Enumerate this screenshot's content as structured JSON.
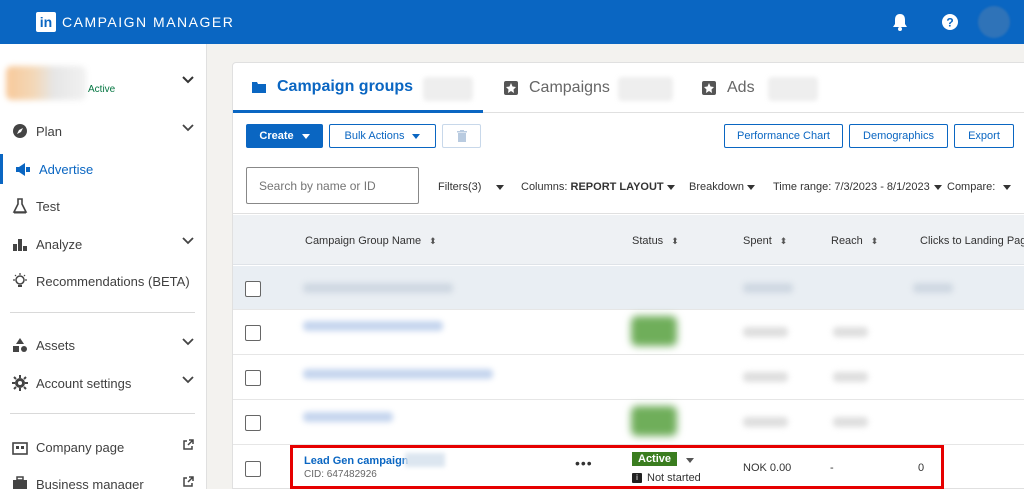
{
  "app": {
    "brand": "CAMPAIGN MANAGER",
    "logo": "in"
  },
  "account": {
    "status": "Active"
  },
  "sidebar": {
    "items": [
      {
        "label": "Plan",
        "icon": "compass-icon",
        "chevron": true
      },
      {
        "label": "Advertise",
        "icon": "megaphone-icon",
        "active": true
      },
      {
        "label": "Test",
        "icon": "flask-icon"
      },
      {
        "label": "Analyze",
        "icon": "bar-chart-icon",
        "chevron": true
      },
      {
        "label": "Recommendations (BETA)",
        "icon": "lightbulb-icon"
      },
      {
        "label": "Assets",
        "icon": "shapes-icon",
        "chevron": true
      },
      {
        "label": "Account settings",
        "icon": "gear-icon",
        "chevron": true
      },
      {
        "label": "Company page",
        "icon": "building-icon",
        "external": true
      },
      {
        "label": "Business manager",
        "icon": "briefcase-icon",
        "external": true
      }
    ]
  },
  "tabs": [
    {
      "label": "Campaign groups",
      "icon": "folder-icon",
      "active": true
    },
    {
      "label": "Campaigns",
      "icon": "campaign-icon"
    },
    {
      "label": "Ads",
      "icon": "ad-icon"
    }
  ],
  "toolbar": {
    "create": "Create",
    "bulk_actions": "Bulk Actions",
    "performance_chart": "Performance Chart",
    "demographics": "Demographics",
    "export": "Export"
  },
  "filters": {
    "search_placeholder": "Search by name or ID",
    "filters_label": "Filters(3)",
    "columns_label": "Columns:",
    "columns_value": "REPORT LAYOUT",
    "breakdown": "Breakdown",
    "time_range": "Time range: 7/3/2023 - 8/1/2023",
    "compare": "Compare:"
  },
  "table": {
    "columns": [
      "Campaign Group Name",
      "Status",
      "Spent",
      "Reach",
      "Clicks to Landing Pag"
    ],
    "highlighted_row": {
      "name": "Lead Gen campaign",
      "cid": "CID: 647482926",
      "more": "•••",
      "status": "Active",
      "sub_status": "Not started",
      "spent": "NOK 0.00",
      "reach": "-",
      "clicks": "0"
    }
  },
  "colors": {
    "brand": "#0a66c2",
    "active_status": "#3a7d1f",
    "highlight": "#e60000"
  }
}
